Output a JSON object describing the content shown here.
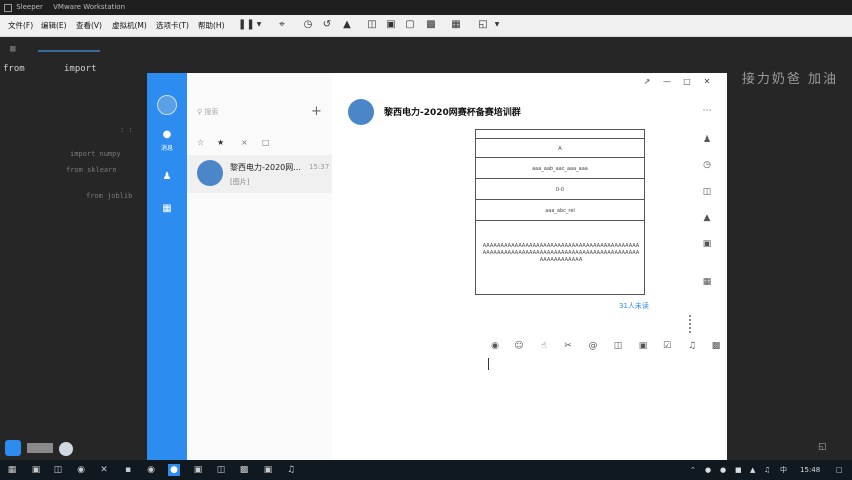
{
  "vm_window": {
    "title_app": "Sleeper",
    "title_product": "VMware Workstation"
  },
  "menu": {
    "items": [
      "文件(F)",
      "编辑(E)",
      "查看(V)",
      "虚拟机(M)",
      "选项卡(T)",
      "帮助(H)"
    ]
  },
  "desktop": {
    "code_from": "from",
    "code_import": "import",
    "right_text": "接力奶爸 加油",
    "faint_lines": [
      "import numpy",
      ": :",
      "from sklearn",
      "from joblib"
    ]
  },
  "qq": {
    "side_label": "消息",
    "search_placeholder": "搜索",
    "plus": "+",
    "conversation": {
      "name": "黎西电力-2020网...",
      "time": "15:37",
      "preview": "[图片]"
    },
    "chat_title": "黎西电力-2020网赛杯备赛培训群",
    "doc_rows": [
      "A",
      "aaa_aab_aac_aaa_aaa",
      "0-0",
      "aaa_abc_rel"
    ],
    "doc_text": "AAAAAAAAAAAAAAAAAAAAAAAAAAAAAAAAAAAAAAAAAAAAAAAAAAAAAAAAAAAAAAAAAAAAAAAAAAAAAAAAAAAAAAAAAAAAAAAAAAAA",
    "unread_text": "31人未读"
  },
  "taskbar": {
    "ime": "中",
    "time": "15:48"
  },
  "colors": {
    "qq_blue": "#2d8cf0",
    "desktop_dark": "#262626"
  }
}
